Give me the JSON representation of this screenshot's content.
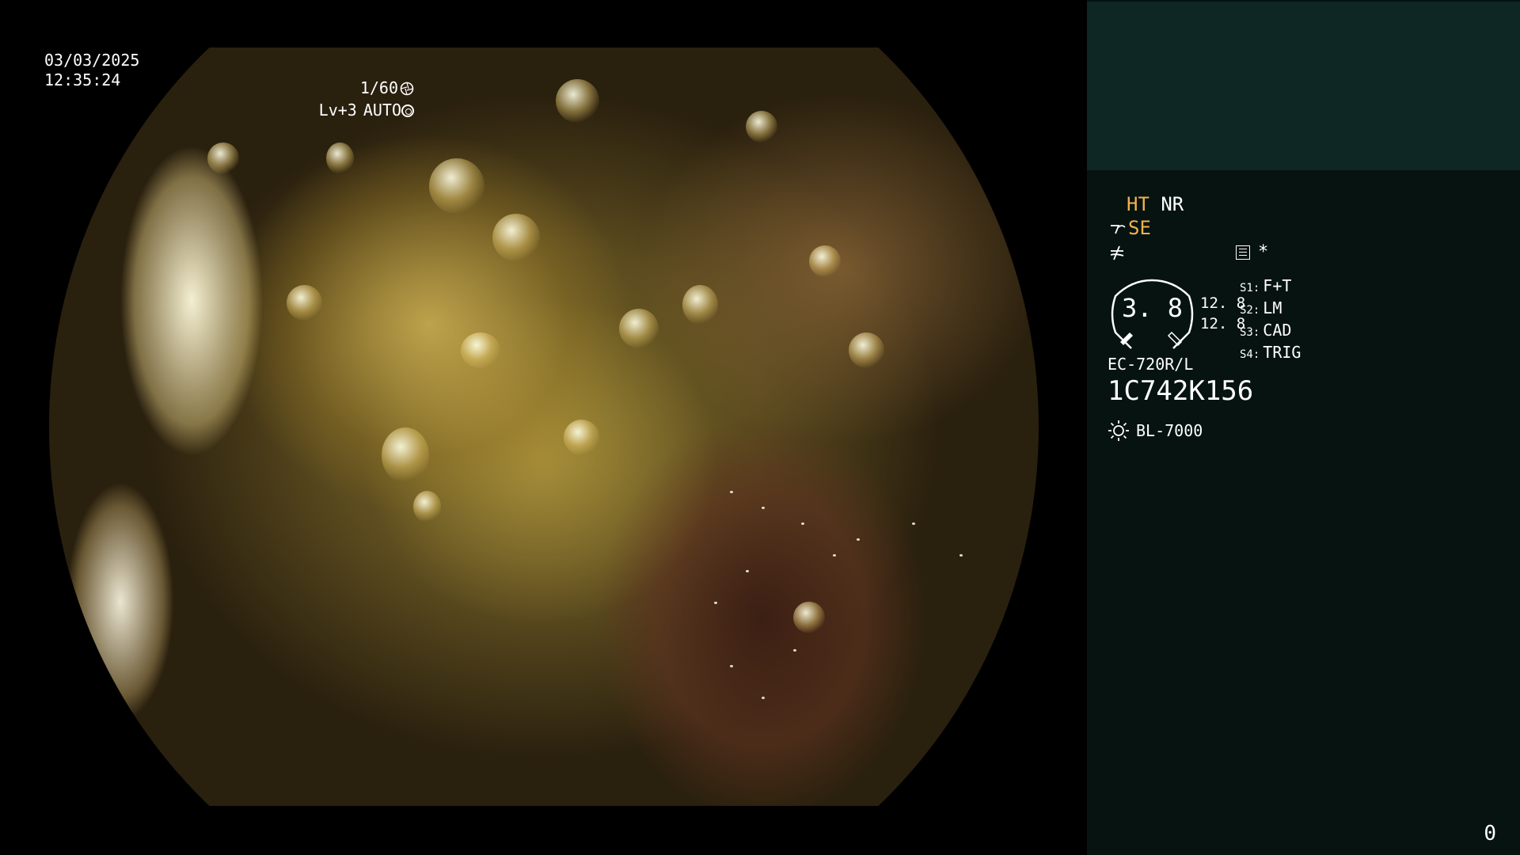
{
  "overlay": {
    "date": "03/03/2025",
    "time": "12:35:24",
    "shutter": "1/60",
    "level": "Lv+3",
    "iris_mode": "AUTO"
  },
  "panel": {
    "ht": "HT",
    "nr": "NR",
    "se": "SE",
    "asterisk": "*",
    "gauge_value": "3. 8",
    "gauge_side_1": "12. 8",
    "gauge_side_2": "12. 8",
    "switches": [
      {
        "key": "S1:",
        "label": "F+T"
      },
      {
        "key": "S2:",
        "label": "LM"
      },
      {
        "key": "S3:",
        "label": "CAD"
      },
      {
        "key": "S4:",
        "label": "TRIG"
      }
    ],
    "scope_model": "EC-720R/L",
    "scope_serial": "1C742K156",
    "light_source": "BL-7000",
    "counter": "0"
  },
  "colors": {
    "accent": "#f2b24a",
    "panel_bg": "#061311",
    "thumb_bg": "#0e2624"
  },
  "icons": {
    "shutter": "aperture-icon",
    "iris": "iris-icon",
    "enhance": "scope-tip-icon",
    "menu": "menu-icon",
    "light": "sun-icon"
  }
}
